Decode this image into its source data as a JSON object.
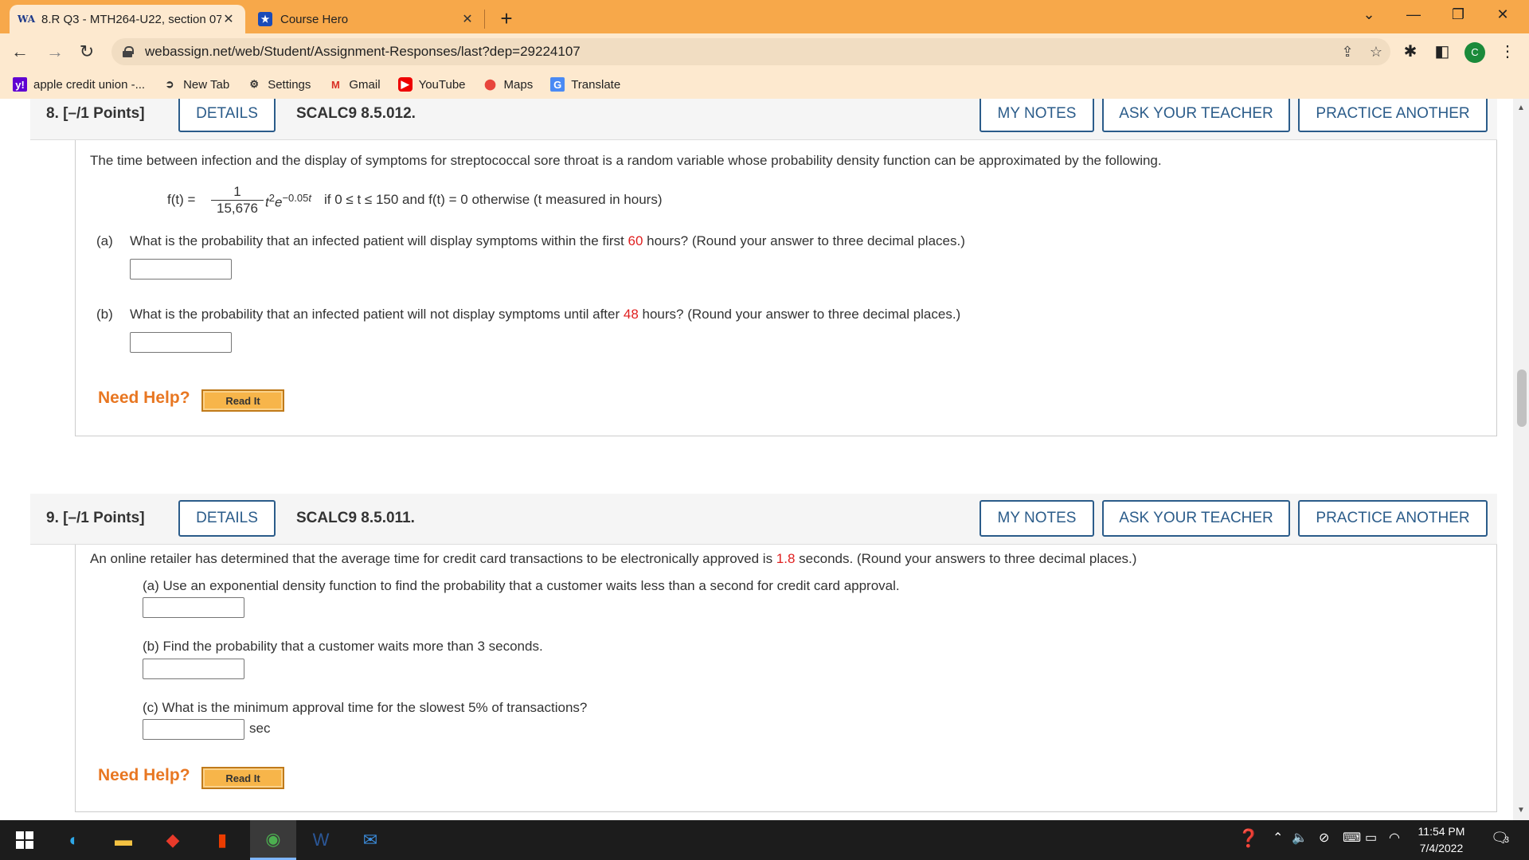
{
  "browser": {
    "tabs": [
      {
        "title": "8.R Q3 - MTH264-U22, section 07",
        "favicon": "WA"
      },
      {
        "title": "Course Hero",
        "favicon": "★"
      }
    ],
    "url": "webassign.net/web/Student/Assignment-Responses/last?dep=29224107",
    "profile_initial": "C",
    "bookmarks": [
      {
        "label": "apple credit union -...",
        "icon": "y!"
      },
      {
        "label": "New Tab",
        "icon": "new-tab-icon"
      },
      {
        "label": "Settings",
        "icon": "gear-icon"
      },
      {
        "label": "Gmail",
        "icon": "gmail-icon"
      },
      {
        "label": "YouTube",
        "icon": "youtube-icon"
      },
      {
        "label": "Maps",
        "icon": "maps-icon"
      },
      {
        "label": "Translate",
        "icon": "translate-icon"
      }
    ]
  },
  "q8": {
    "number": "8.  [–/1 Points]",
    "details": "DETAILS",
    "code": "SCALC9 8.5.012.",
    "my_notes": "MY NOTES",
    "ask_teacher": "ASK YOUR TEACHER",
    "practice": "PRACTICE ANOTHER",
    "intro": "The time between infection and the display of symptoms for streptococcal sore throat is a random variable whose probability density function can be approximated by the following.",
    "formula_lhs": "f(t) =",
    "formula_num": "1",
    "formula_den": "15,676",
    "formula_rest": "if 0 ≤ t ≤ 150 and f(t) = 0 otherwise (t measured in hours)",
    "a_label": "(a)",
    "a_pre": "What is the probability that an infected patient will display symptoms within the first ",
    "a_val": "60",
    "a_post": " hours? (Round your answer to three decimal places.)",
    "b_label": "(b)",
    "b_pre": "What is the probability that an infected patient will not display symptoms until after ",
    "b_val": "48",
    "b_post": " hours? (Round your answer to three decimal places.)",
    "need_help": "Need Help?",
    "read_it": "Read It"
  },
  "q9": {
    "number": "9.  [–/1 Points]",
    "details": "DETAILS",
    "code": "SCALC9 8.5.011.",
    "my_notes": "MY NOTES",
    "ask_teacher": "ASK YOUR TEACHER",
    "practice": "PRACTICE ANOTHER",
    "intro_pre": "An online retailer has determined that the average time for credit card transactions to be electronically approved is ",
    "intro_val": "1.8",
    "intro_post": " seconds. (Round your answers to three decimal places.)",
    "a_text": "(a) Use an exponential density function to find the probability that a customer waits less than a second for credit card approval.",
    "b_text": "(b) Find the probability that a customer waits more than 3 seconds.",
    "c_text": "(c) What is the minimum approval time for the slowest 5% of transactions?",
    "c_unit": "sec",
    "need_help": "Need Help?",
    "read_it": "Read It"
  },
  "taskbar": {
    "time": "11:54 PM",
    "date": "7/4/2022",
    "notifications": "3"
  }
}
